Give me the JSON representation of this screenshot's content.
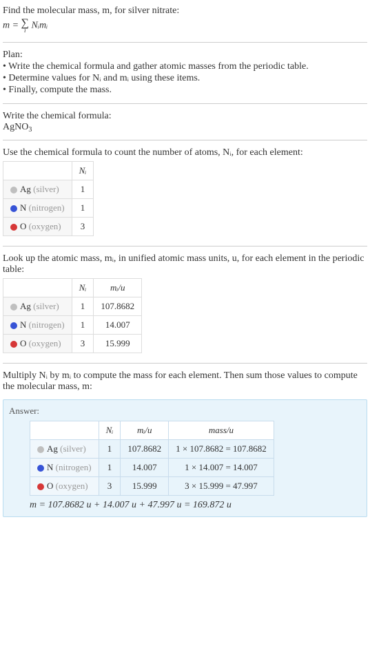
{
  "intro": {
    "line1": "Find the molecular mass, m, for silver nitrate:",
    "formula_lhs": "m = ",
    "formula_sigma": "∑",
    "formula_sub": "i",
    "formula_rhs": " Nᵢmᵢ"
  },
  "plan": {
    "title": "Plan:",
    "b1": "• Write the chemical formula and gather atomic masses from the periodic table.",
    "b2": "• Determine values for Nᵢ and mᵢ using these items.",
    "b3": "• Finally, compute the mass."
  },
  "chemformula": {
    "title": "Write the chemical formula:",
    "value": "AgNO",
    "sub": "3"
  },
  "count": {
    "title": "Use the chemical formula to count the number of atoms, Nᵢ, for each element:",
    "header_n": "Nᵢ",
    "rows": [
      {
        "sym": "Ag",
        "name": "(silver)",
        "dot": "dot-ag",
        "n": "1"
      },
      {
        "sym": "N",
        "name": "(nitrogen)",
        "dot": "dot-n",
        "n": "1"
      },
      {
        "sym": "O",
        "name": "(oxygen)",
        "dot": "dot-o",
        "n": "3"
      }
    ]
  },
  "lookup": {
    "title": "Look up the atomic mass, mᵢ, in unified atomic mass units, u, for each element in the periodic table:",
    "header_n": "Nᵢ",
    "header_m": "mᵢ/u",
    "rows": [
      {
        "sym": "Ag",
        "name": "(silver)",
        "dot": "dot-ag",
        "n": "1",
        "m": "107.8682"
      },
      {
        "sym": "N",
        "name": "(nitrogen)",
        "dot": "dot-n",
        "n": "1",
        "m": "14.007"
      },
      {
        "sym": "O",
        "name": "(oxygen)",
        "dot": "dot-o",
        "n": "3",
        "m": "15.999"
      }
    ]
  },
  "multiply": {
    "title": "Multiply Nᵢ by mᵢ to compute the mass for each element. Then sum those values to compute the molecular mass, m:"
  },
  "answer": {
    "label": "Answer:",
    "header_n": "Nᵢ",
    "header_m": "mᵢ/u",
    "header_mass": "mass/u",
    "rows": [
      {
        "sym": "Ag",
        "name": "(silver)",
        "dot": "dot-ag",
        "n": "1",
        "m": "107.8682",
        "mass": "1 × 107.8682 = 107.8682"
      },
      {
        "sym": "N",
        "name": "(nitrogen)",
        "dot": "dot-n",
        "n": "1",
        "m": "14.007",
        "mass": "1 × 14.007 = 14.007"
      },
      {
        "sym": "O",
        "name": "(oxygen)",
        "dot": "dot-o",
        "n": "3",
        "m": "15.999",
        "mass": "3 × 15.999 = 47.997"
      }
    ],
    "final": "m = 107.8682 u + 14.007 u + 47.997 u = 169.872 u"
  }
}
